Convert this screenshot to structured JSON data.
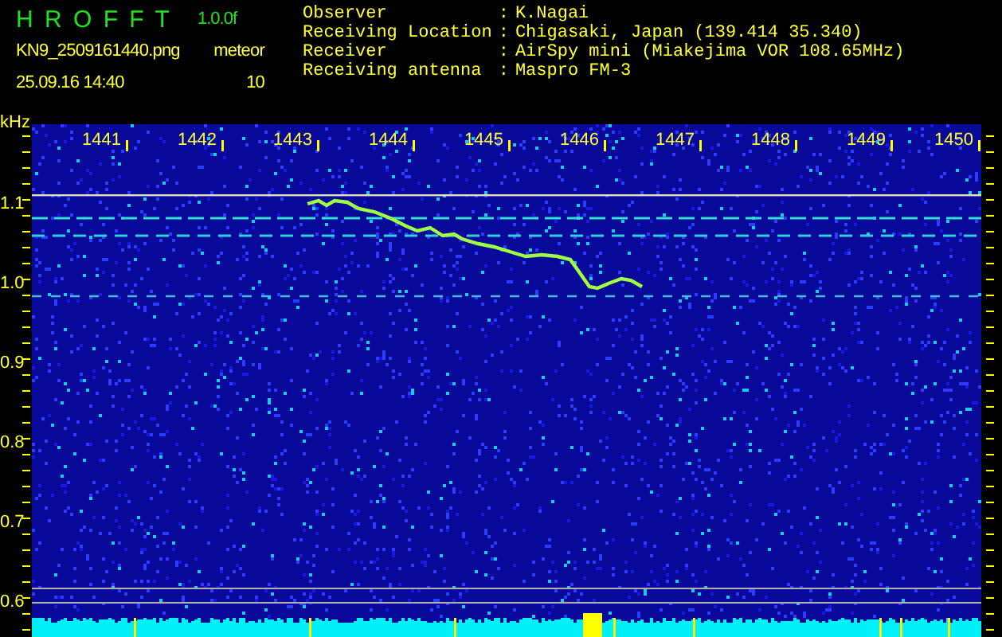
{
  "header": {
    "title": "H R O F F T",
    "version": "1.0.0f",
    "file_name": "KN9_2509161440.png",
    "mode": "meteor",
    "timestamp": "25.09.16 14:40",
    "count": "10"
  },
  "info": [
    {
      "label": "Observer",
      "separator": ":",
      "value": "K.Nagai"
    },
    {
      "label": "Receiving Location",
      "separator": ":",
      "value": "Chigasaki, Japan (139.414 35.340)"
    },
    {
      "label": "Receiver",
      "separator": ":",
      "value": "AirSpy mini (Miakejima VOR 108.65MHz)"
    },
    {
      "label": "Receiving antenna",
      "separator": ":",
      "value": "Maspro FM-3"
    }
  ],
  "spectrogram": {
    "y_unit": "kHz",
    "x_ticks": [
      "1441",
      "1442",
      "1443",
      "1444",
      "1445",
      "1446",
      "1447",
      "1448",
      "1449",
      "1450"
    ],
    "y_ticks": [
      "1.1",
      "1.0",
      "0.9",
      "0.8",
      "0.7",
      "0.6"
    ]
  }
}
